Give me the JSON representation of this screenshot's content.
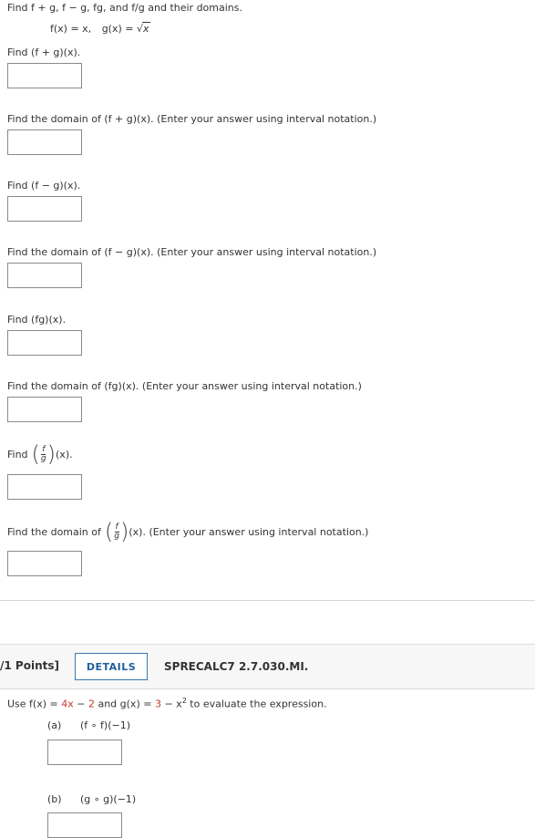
{
  "problem1": {
    "intro": "Find f + g, f − g, fg, and f/g and their domains.",
    "functions": {
      "f_def": "f(x) = x,",
      "g_def": "g(x) = ",
      "g_radicand": "x"
    },
    "q1": "Find (f + g)(x).",
    "q2": "Find the domain of (f + g)(x). (Enter your answer using interval notation.)",
    "q3": "Find (f − g)(x).",
    "q4": "Find the domain of (f − g)(x). (Enter your answer using interval notation.)",
    "q5": "Find (fg)(x).",
    "q6": "Find the domain of (fg)(x). (Enter your answer using interval notation.)",
    "q7_prefix": "Find",
    "q7_suffix": "(x).",
    "q8_prefix": "Find the domain of",
    "q8_suffix": "(x). (Enter your answer using interval notation.)",
    "frac_num": "f",
    "frac_den": "g"
  },
  "problem2": {
    "points": "/1 Points]",
    "details_label": "DETAILS",
    "code": "SPRECALC7 2.7.030.MI.",
    "use_prefix": "Use f(x) =",
    "f_expr_a": "4x",
    "f_expr_mid": " − ",
    "f_expr_b": "2",
    "and_g": " and g(x) = ",
    "g_expr_a": "3",
    "g_expr_mid": " − x",
    "g_exp": "2",
    "use_suffix": " to evaluate the expression.",
    "part_a_label": "(a)",
    "part_a_expr": "(f ∘ f)(−1)",
    "part_b_label": "(b)",
    "part_b_expr": "(g ∘ g)(−1)"
  },
  "colors": {
    "accent": "#1f5f9a",
    "highlight": "#c0392b"
  }
}
